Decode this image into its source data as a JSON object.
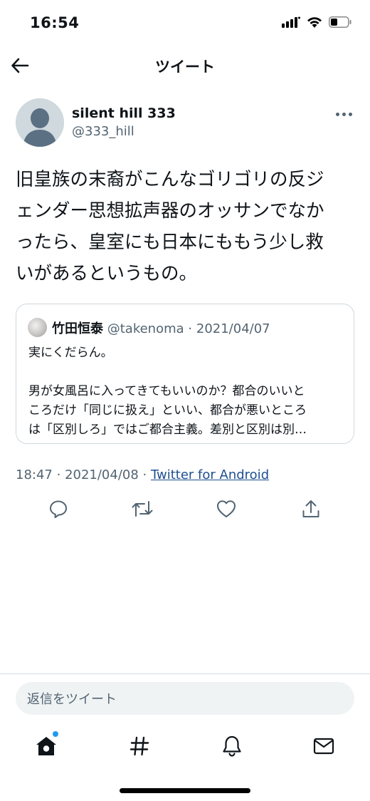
{
  "status_bar": {
    "time": "16:54"
  },
  "header": {
    "title": "ツイート"
  },
  "tweet": {
    "author_name": "silent hill 333",
    "author_handle": "@333_hill",
    "text_lines": [
      "旧皇族の末裔がこんなゴリゴリの反ジ",
      "ェンダー思想拡声器のオッサンでなか",
      "ったら、皇室にも日本にももう少し救",
      "いがあるというもの。"
    ],
    "time": "18:47",
    "date": "2021/04/08",
    "source": "Twitter for Android"
  },
  "quoted_tweet": {
    "author_name": "竹田恒泰",
    "author_handle": "@takenoma",
    "date": "2021/04/07",
    "lines": [
      "実にくだらん。",
      "",
      "男が女風呂に入ってきてもいいのか？都合のいいと",
      "ころだけ「同じに扱え」といい、都合が悪いところ",
      "は「区別しろ」ではご都合主義。差別と区別は別…"
    ]
  },
  "reply_box": {
    "placeholder": "返信をツイート"
  },
  "icons": {
    "back": "arrow-left-icon",
    "more": "more-horizontal-icon",
    "reply": "reply-icon",
    "retweet": "retweet-icon",
    "like": "heart-icon",
    "share": "share-icon",
    "home": "home-icon",
    "explore": "hashtag-icon",
    "notifications": "bell-icon",
    "messages": "mail-icon"
  },
  "colors": {
    "text": "#0f1419",
    "secondary": "#536471",
    "accent": "#1d9bf0",
    "link": "#1d4f91"
  }
}
